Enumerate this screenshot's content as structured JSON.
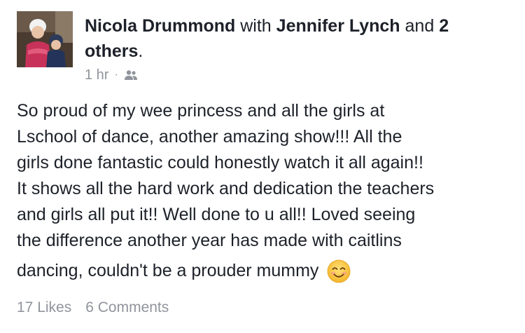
{
  "post": {
    "author": "Nicola Drummond",
    "with_word": "with",
    "tagged_name": "Jennifer Lynch",
    "and_word": "and",
    "others_count": "2",
    "others_word": "others",
    "period": ".",
    "timestamp": "1 hr",
    "separator": "·",
    "audience_icon": "friends-icon",
    "body_lines": [
      "So proud of my wee princess and all the girls at",
      "Lschool of dance, another amazing show!!! All the",
      "girls done fantastic could honestly watch it all again!!",
      "It shows all the hard work and dedication the teachers",
      "and girls all put it!! Well done to u all!! Loved seeing",
      "the difference another year has made with caitlins",
      "dancing, couldn't be a prouder mummy"
    ],
    "emoji_icon": "smiling-face-emoji-icon",
    "likes": "17 Likes",
    "comments": "6 Comments"
  }
}
